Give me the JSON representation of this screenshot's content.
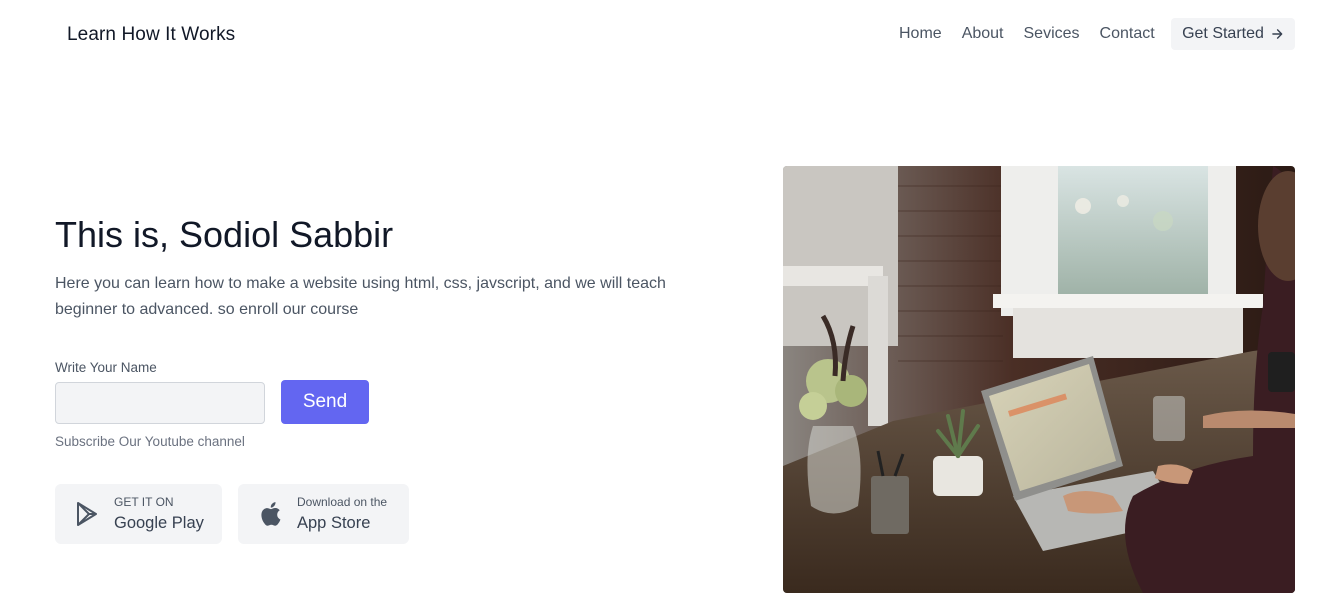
{
  "header": {
    "brand": "Learn How It Works",
    "nav": [
      "Home",
      "About",
      "Sevices",
      "Contact"
    ],
    "cta_label": "Get Started"
  },
  "hero": {
    "title": "This is, Sodiol Sabbir",
    "description": "Here you can learn how to make a website using html, css, javscript, and we will teach beginner to advanced. so enroll our course",
    "name_label": "Write Your Name",
    "name_value": "",
    "send_label": "Send",
    "subscribe_note": "Subscribe Our Youtube channel"
  },
  "stores": {
    "google": {
      "small": "GET IT ON",
      "big": "Google Play",
      "icon": "google-play-icon"
    },
    "apple": {
      "small": "Download on the",
      "big": "App Store",
      "icon": "apple-icon"
    }
  },
  "image": {
    "subject": "person working on a laptop at a wooden table with plants"
  },
  "colors": {
    "accent": "#6366f1",
    "button_bg": "#f3f4f6",
    "text_dark": "#111827",
    "text_muted": "#4b5563"
  }
}
